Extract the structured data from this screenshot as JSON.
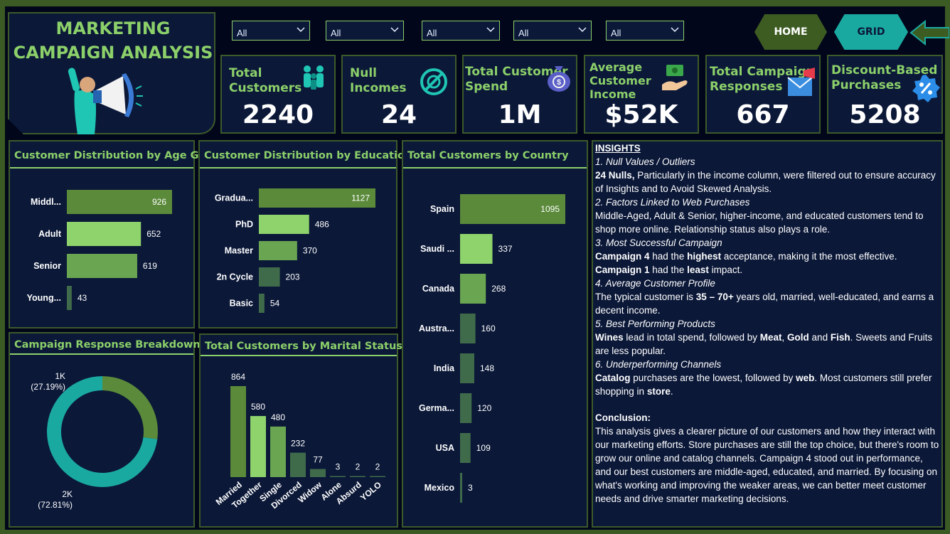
{
  "title": {
    "line1": "MARKETING",
    "line2": "CAMPAIGN ANALYSIS"
  },
  "filters": [
    {
      "value": "All"
    },
    {
      "value": "All"
    },
    {
      "value": "All"
    },
    {
      "value": "All"
    },
    {
      "value": "All"
    }
  ],
  "nav": {
    "home": "HOME",
    "grid": "GRID"
  },
  "kpis": [
    {
      "label1": "Total",
      "label2": "Customers",
      "value": "2240",
      "icon": "people-icon"
    },
    {
      "label1": "Null",
      "label2": "Incomes",
      "value": "24",
      "icon": "null-icon"
    },
    {
      "label1": "Total Customer",
      "label2": "Spend",
      "value": "1M",
      "icon": "money-bag-icon"
    },
    {
      "label1": "Average",
      "label2": "Customer",
      "label3": "Income",
      "value": "$52K",
      "icon": "hand-money-icon"
    },
    {
      "label1": "Total Campaign",
      "label2": "Responses",
      "value": "667",
      "icon": "megaphone-mail-icon"
    },
    {
      "label1": "Discount-Based",
      "label2": "Purchases",
      "value": "5208",
      "icon": "discount-badge-icon"
    }
  ],
  "colors": {
    "dark_green": "#5a8a3a",
    "light_green": "#8ed36b",
    "mid_green": "#6aa652",
    "teal": "#1aa9a1",
    "muted": "#3f6b4a"
  },
  "chart_data": [
    {
      "type": "bar",
      "title": "Customer Distribution by Age Group",
      "categories": [
        "Middl...",
        "Adult",
        "Senior",
        "Young..."
      ],
      "values": [
        926,
        652,
        619,
        43
      ],
      "orientation": "horizontal"
    },
    {
      "type": "bar",
      "title": "Customer Distribution by Education",
      "categories": [
        "Gradua...",
        "PhD",
        "Master",
        "2n Cycle",
        "Basic"
      ],
      "values": [
        1127,
        486,
        370,
        203,
        54
      ],
      "orientation": "horizontal"
    },
    {
      "type": "bar",
      "title": "Total Customers by Country",
      "categories": [
        "Spain",
        "Saudi ...",
        "Canada",
        "Austra...",
        "India",
        "Germa...",
        "USA",
        "Mexico"
      ],
      "values": [
        1095,
        337,
        268,
        160,
        148,
        120,
        109,
        3
      ],
      "orientation": "horizontal"
    },
    {
      "type": "pie",
      "title": "Campaign Response Breakdown",
      "slices": [
        {
          "label": "1K",
          "pct": "(27.19%)",
          "value": 27.19,
          "color": "#5a8a3a"
        },
        {
          "label": "2K",
          "pct": "(72.81%)",
          "value": 72.81,
          "color": "#1aa9a1"
        }
      ],
      "donut": true
    },
    {
      "type": "bar",
      "title": "Total Customers by Marital Status",
      "categories": [
        "Married",
        "Together",
        "Single",
        "Divorced",
        "Widow",
        "Alone",
        "Absurd",
        "YOLO"
      ],
      "values": [
        864,
        580,
        480,
        232,
        77,
        3,
        2,
        2
      ],
      "orientation": "vertical"
    }
  ],
  "insights": {
    "heading": "INSIGHTS",
    "s1_title": "1. Null Values / Outliers",
    "s1_bold": "24 Nulls,",
    "s1_text": " Particularly in the income column, were filtered out to ensure accuracy of Insights and to Avoid Skewed Analysis.",
    "s2_title": "2. Factors Linked to Web Purchases",
    "s2_text": "Middle-Aged, Adult & Senior, higher-income, and educated customers tend to shop more online. Relationship status also plays a role.",
    "s3_title": "3. Most Successful Campaign",
    "s3_b1": "Campaign 4",
    "s3_t1": " had the ",
    "s3_b2": "highest",
    "s3_t2": " acceptance, making it the most effective.",
    "s3_b3": "Campaign 1",
    "s3_t3": " had the ",
    "s3_b4": "least",
    "s3_t4": " impact.",
    "s4_title": "4. Average Customer Profile",
    "s4_t1": "The typical customer is ",
    "s4_b1": "35 – 70+",
    "s4_t2": " years old, married, well-educated, and earns a decent income.",
    "s5_title": "5. Best Performing Products",
    "s5_b1": "Wines",
    "s5_t1": " lead in total spend, followed by ",
    "s5_b2": "Meat",
    "s5_t2": ", ",
    "s5_b3": "Gold",
    "s5_t3": " and ",
    "s5_b4": "Fish",
    "s5_t4": ". Sweets and Fruits are less popular.",
    "s6_title": "6. Underperforming Channels",
    "s6_b1": "Catalog",
    "s6_t1": " purchases are the lowest, followed by ",
    "s6_b2": "web",
    "s6_t2": ". Most customers still prefer shopping in ",
    "s6_b3": "store",
    "s6_t3": ".",
    "conclusion_title": "Conclusion:",
    "conclusion_text": "This analysis gives a clearer picture of our customers and how they interact with our marketing efforts. Store purchases are still the top choice, but there's room to grow our online and catalog channels. Campaign 4 stood out in performance, and our best customers are middle-aged, educated, and married. By focusing on what's working and improving the weaker areas, we can better meet customer needs and drive smarter marketing decisions."
  }
}
